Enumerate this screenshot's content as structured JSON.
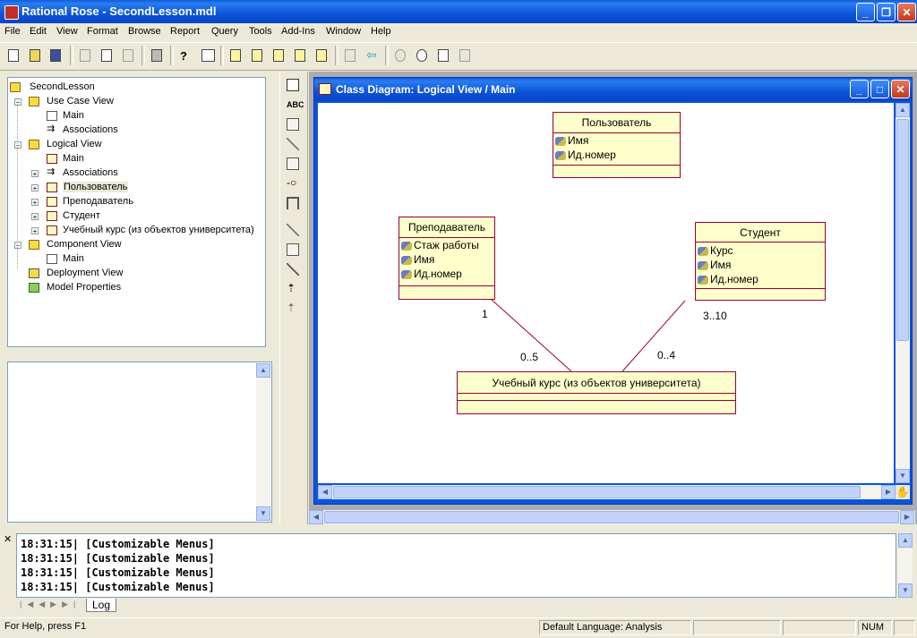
{
  "app": {
    "title": "Rational Rose - SecondLesson.mdl"
  },
  "menu": [
    "File",
    "Edit",
    "View",
    "Format",
    "Browse",
    "Report",
    "Query",
    "Tools",
    "Add-Ins",
    "Window",
    "Help"
  ],
  "tree": {
    "root": "SecondLesson",
    "use_case_view": "Use Case View",
    "ucv_main": "Main",
    "ucv_associations": "Associations",
    "logical_view": "Logical View",
    "lv_main": "Main",
    "lv_associations": "Associations",
    "cls_user": "Пользователь",
    "cls_teacher": "Преподаватель",
    "cls_student": "Студент",
    "cls_course": "Учебный курс (из объектов университета)",
    "component_view": "Component View",
    "cv_main": "Main",
    "deployment_view": "Deployment View",
    "model_properties": "Model Properties"
  },
  "diagram": {
    "title": "Class Diagram: Logical View / Main",
    "classes": {
      "user": {
        "name": "Пользователь",
        "attrs": [
          "Имя",
          "Ид.номер"
        ]
      },
      "teacher": {
        "name": "Преподаватель",
        "attrs": [
          "Стаж работы",
          "Имя",
          "Ид.номер"
        ]
      },
      "student": {
        "name": "Студент",
        "attrs": [
          "Курс",
          "Имя",
          "Ид.номер"
        ]
      },
      "course": {
        "name": "Учебный курс (из объектов университета)",
        "attrs": []
      }
    },
    "multiplicities": {
      "teacher_end": "1",
      "course_teacher_end": "0..5",
      "student_end": "3..10",
      "course_student_end": "0..4"
    }
  },
  "log": {
    "lines": [
      "18:31:15|  [Customizable Menus]",
      "18:31:15|  [Customizable Menus]",
      "18:31:15|  [Customizable Menus]",
      "18:31:15|  [Customizable Menus]"
    ],
    "tab": "Log"
  },
  "status": {
    "help": "For Help, press F1",
    "language": "Default Language: Analysis",
    "num": "NUM"
  }
}
